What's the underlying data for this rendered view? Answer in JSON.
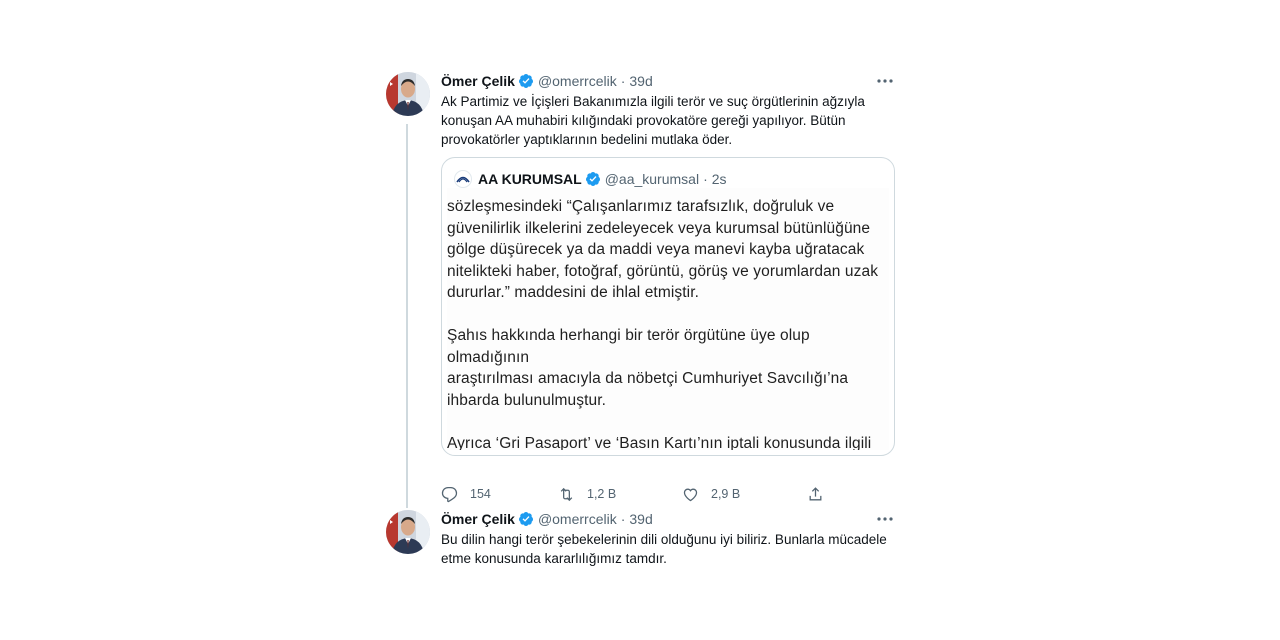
{
  "tweet1": {
    "name": "Ömer Çelik",
    "handle": "@omerrcelik",
    "sep": "·",
    "time": "39d",
    "text": "Ak Partimiz ve İçişleri Bakanımızla ilgili terör ve suç örgütlerinin ağzıyla\nkonuşan AA muhabiri kılığındaki provokatöre gereği yapılıyor. Bütün\nprovokatörler yaptıklarının bedelini mutlaka öder.",
    "quote": {
      "name": "AA KURUMSAL",
      "handle": "@aa_kurumsal",
      "sep": "·",
      "time": "2s",
      "cut_line": "...",
      "body": "sözleşmesindeki “Çalışanlarımız tarafsızlık, doğruluk ve\ngüvenilirlik ilkelerini zedeleyecek veya kurumsal bütünlüğüne\ngölge düşürecek ya da maddi veya manevi kayba uğratacak\nnitelikteki haber, fotoğraf, görüntü, görüş ve yorumlardan uzak\ndururlar.” maddesini de ihlal etmiştir.\n\nŞahıs hakkında herhangi bir terör örgütüne üye olup olmadığının\naraştırılması amacıyla da nöbetçi Cumhuriyet Savcılığı’na\nihbarda bulunulmuştur.\n\nAyrıca ‘Gri Pasaport’ ve ‘Basın Kartı’nın iptali konusunda ilgili\nkurumlara Turan hakkında bildirim yapılmıştır."
    },
    "actions": {
      "replies": "154",
      "retweets": "1,2 B",
      "likes": "2,9 B"
    }
  },
  "tweet2": {
    "name": "Ömer Çelik",
    "handle": "@omerrcelik",
    "sep": "·",
    "time": "39d",
    "text": "Bu dilin hangi terör şebekelerinin dili olduğunu iyi biliriz. Bunlarla mücadele\netme konusunda kararlılığımız tamdır."
  },
  "colors": {
    "verified": "#1d9bf0",
    "secondary_text": "#536471",
    "border": "#cfd9de"
  }
}
